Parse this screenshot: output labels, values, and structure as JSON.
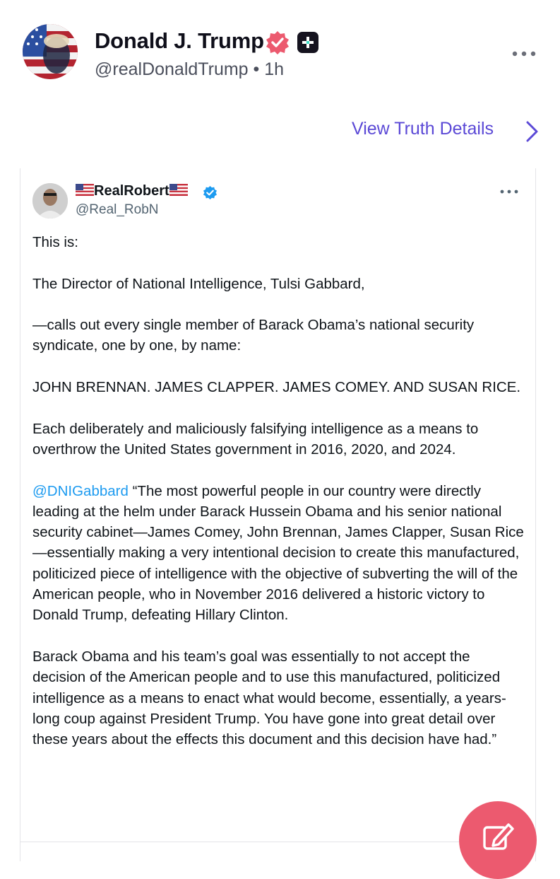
{
  "post": {
    "author_name": "Donald J. Trump",
    "handle": "@realDonaldTrump",
    "separator": "•",
    "time": "1h",
    "view_details": "View Truth Details"
  },
  "embed": {
    "name": "RealRobert",
    "handle": "@Real_RobN",
    "paragraphs": [
      "This is:",
      "The Director of National Intelligence, Tulsi Gabbard,",
      "—calls out every single member of Barack Obama’s national security syndicate, one by one, by name:",
      "JOHN BRENNAN. JAMES CLAPPER. JAMES COMEY. AND SUSAN RICE.",
      "Each deliberately and maliciously falsifying intelligence as a means to overthrow the United States government in 2016, 2020, and 2024."
    ],
    "mention": "@DNIGabbard",
    "quote": "“The most powerful people in our country were directly leading at the helm under Barack Hussein Obama and his senior national security cabinet—James Comey, John Brennan, James Clapper, Susan Rice—essentially making a very intentional decision to create this manufactured, politicized piece of intelligence with the objective of subverting the will of the American people, who in November 2016 delivered a historic victory to Donald Trump, defeating Hillary Clinton.",
    "last_paragraph": "Barack Obama and his team’s goal was essentially to not accept the decision of the American people and to use this manufactured, politicized intelligence as a means to enact what would become, essentially, a years-long coup against President Trump. You have gone into great detail over these years about the effects this document and this decision have had.”"
  },
  "colors": {
    "link_purple": "#5b49d6",
    "mention_blue": "#1d9bf0",
    "verified_pink": "#ec5a6f",
    "verified_blue": "#1d9bf0"
  },
  "icons": [
    "avatar",
    "verified-badge-icon",
    "plus-badge-icon",
    "more-options-icon",
    "chevron-right-icon",
    "flag-icon",
    "compose-icon"
  ]
}
